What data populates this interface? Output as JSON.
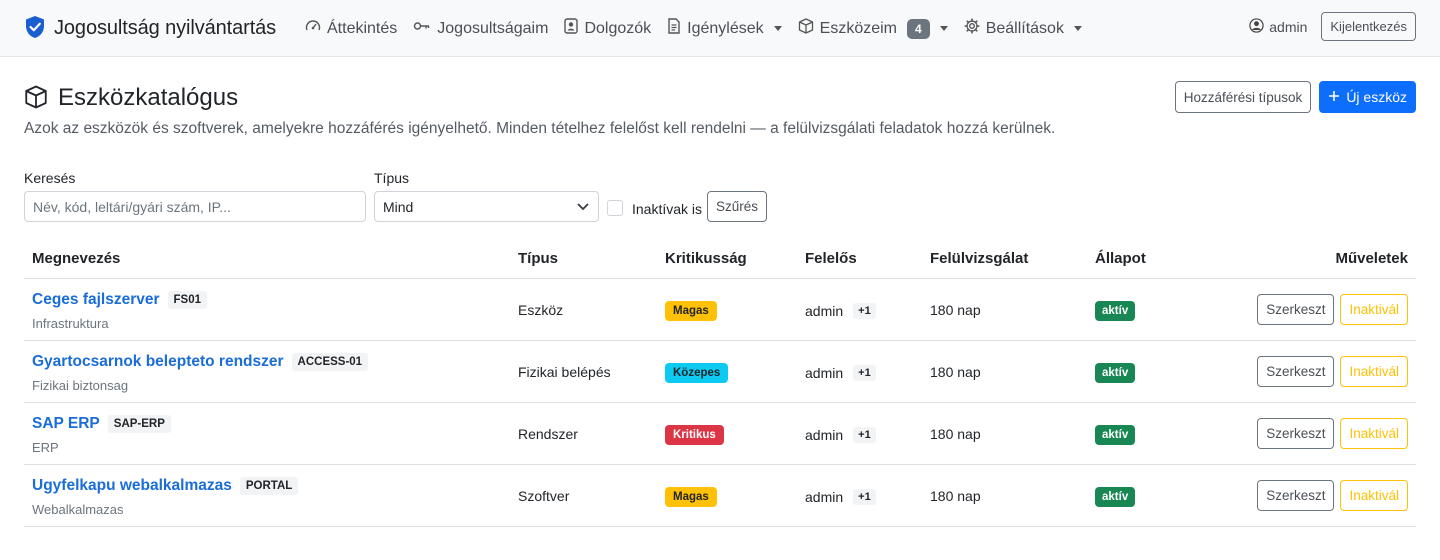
{
  "navbar": {
    "brand": "Jogosultság nyilvántartás",
    "items": [
      {
        "label": "Áttekintés",
        "icon": "speedometer-icon"
      },
      {
        "label": "Jogosultságaim",
        "icon": "key-icon"
      },
      {
        "label": "Dolgozók",
        "icon": "person-badge-icon"
      },
      {
        "label": "Igénylések",
        "icon": "file-text-icon"
      },
      {
        "label": "Eszközeim",
        "icon": "box-icon",
        "badge": "4"
      },
      {
        "label": "Beállítások",
        "icon": "gear-icon"
      }
    ],
    "user": "admin",
    "logout": "Kijelentkezés"
  },
  "header": {
    "title": "Eszközkatalógus",
    "subtitle": "Azok az eszközök és szoftverek, amelyekre hozzáférés igényelhető. Minden tételhez felelőst kell rendelni — a felülvizsgálati feladatok hozzá kerülnek.",
    "access_types_button": "Hozzáférési típusok",
    "new_button": "Új eszköz"
  },
  "filter": {
    "search_label": "Keresés",
    "search_placeholder": "Név, kód, leltári/gyári szám, IP...",
    "type_label": "Típus",
    "type_value": "Mind",
    "inactive_label": "Inaktívak is",
    "filter_button": "Szűrés"
  },
  "table": {
    "headers": [
      "Megnevezés",
      "Típus",
      "Kritikusság",
      "Felelős",
      "Felülvizsgálat",
      "Állapot",
      "Műveletek"
    ],
    "rows": [
      {
        "name": "Ceges fajlszerver",
        "code": "FS01",
        "group": "Infrastruktura",
        "type": "Eszköz",
        "criticality": "Magas",
        "crit_color": "#ffc107",
        "crit_text_color": "#212529",
        "owner": "admin",
        "owner_extra": "+1",
        "review": "180 nap",
        "status": "aktív"
      },
      {
        "name": "Gyartocsarnok belepteto rendszer",
        "code": "ACCESS-01",
        "group": "Fizikai biztonsag",
        "type": "Fizikai belépés",
        "criticality": "Közepes",
        "crit_color": "#0dcaf0",
        "crit_text_color": "#212529",
        "owner": "admin",
        "owner_extra": "+1",
        "review": "180 nap",
        "status": "aktív"
      },
      {
        "name": "SAP ERP",
        "code": "SAP-ERP",
        "group": "ERP",
        "type": "Rendszer",
        "criticality": "Kritikus",
        "crit_color": "#dc3545",
        "crit_text_color": "#ffffff",
        "owner": "admin",
        "owner_extra": "+1",
        "review": "180 nap",
        "status": "aktív"
      },
      {
        "name": "Ugyfelkapu webalkalmazas",
        "code": "PORTAL",
        "group": "Webalkalmazas",
        "type": "Szoftver",
        "criticality": "Magas",
        "crit_color": "#ffc107",
        "crit_text_color": "#212529",
        "owner": "admin",
        "owner_extra": "+1",
        "review": "180 nap",
        "status": "aktív"
      }
    ],
    "edit_label": "Szerkeszt",
    "inactivate_label": "Inaktivál"
  }
}
